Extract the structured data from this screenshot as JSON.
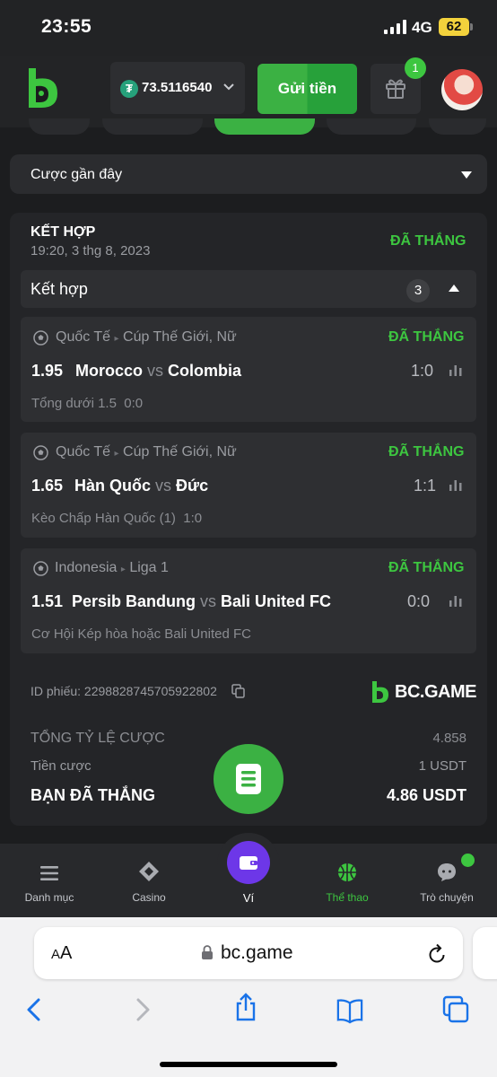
{
  "status_bar": {
    "time": "23:55",
    "network": "4G",
    "battery": "62"
  },
  "header": {
    "balance": "73.5116540",
    "currency_icon": "tether-icon",
    "deposit_label": "Gửi tiền",
    "gift_badge_count": "1"
  },
  "recent_bets": {
    "label": "Cược gần đây"
  },
  "bet": {
    "type": "KẾT HỢP",
    "time": "19:20, 3 thg 8, 2023",
    "status": "ĐÃ THẮNG",
    "combo_label": "Kết hợp",
    "combo_count": "3",
    "legs": [
      {
        "region": "Quốc Tế",
        "league": "Cúp Thế Giới, Nữ",
        "status": "ĐÃ THẮNG",
        "odds": "1.95",
        "home": "Morocco",
        "vs": "vs",
        "away": "Colombia",
        "score": "1:0",
        "market": "Tổng dưới 1.5",
        "market_score": "0:0"
      },
      {
        "region": "Quốc Tế",
        "league": "Cúp Thế Giới, Nữ",
        "status": "ĐÃ THẮNG",
        "odds": "1.65",
        "home": "Hàn Quốc",
        "vs": "vs",
        "away": "Đức",
        "score": "1:1",
        "market": "Kèo Chấp Hàn Quốc (1)",
        "market_score": "1:0"
      },
      {
        "region": "Indonesia",
        "league": "Liga 1",
        "status": "ĐÃ THẮNG",
        "odds": "1.51",
        "home": "Persib Bandung",
        "vs": "vs",
        "away": "Bali United FC",
        "score": "0:0",
        "market": "Cơ Hội Kép hòa hoặc Bali United FC",
        "market_score": ""
      }
    ],
    "ticket_id": "ID phiếu: 2298828745705922802",
    "brand": "BC.GAME",
    "total_odds_label": "TỔNG TỶ LỆ CƯỢC",
    "total_odds_value": "4.858",
    "stake_label": "Tiền cược",
    "stake_value": "1 USDT",
    "win_label": "BẠN ĐÃ THẮNG",
    "win_value": "4.86 USDT"
  },
  "bottom_nav": {
    "items": [
      {
        "label": "Danh mục",
        "icon": "menu-icon"
      },
      {
        "label": "Casino",
        "icon": "casino-icon"
      },
      {
        "label": "Ví",
        "icon": "wallet-icon"
      },
      {
        "label": "Thể thao",
        "icon": "basketball-icon"
      },
      {
        "label": "Trò chuyện",
        "icon": "chat-icon"
      }
    ]
  },
  "browser": {
    "aa_large": "A",
    "aa_small": "A",
    "url": "bc.game"
  },
  "colors": {
    "accent_green": "#3bb143",
    "win_green": "#3dc640",
    "wallet_purple": "#6d37e8"
  }
}
